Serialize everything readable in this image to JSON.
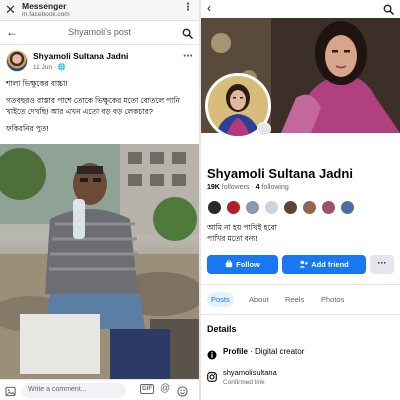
{
  "left": {
    "browser": {
      "title": "Messenger",
      "url": "m.facebook.com"
    },
    "header": {
      "title": "Shyamoli's post"
    },
    "post": {
      "author": "Shyamoli Sultana Jadni",
      "date": "11 Jun",
      "lines": [
        "শালা ভিক্ষুকের বাচ্চা!",
        "গতবছরও রাস্তার পাশে তোকে ভিক্ষুকের মতো বোতলে পানি খাইতে দেখছি! আর এখন এতো বড় বড় লেকচার?",
        "ফকিরনির পুত!"
      ]
    },
    "comment_bar": {
      "placeholder": "Write a comment...",
      "gif_label": "GIF"
    }
  },
  "right": {
    "profile": {
      "name": "Shyamoli Sultana Jadni",
      "followers_count": "19K",
      "followers_label": "followers",
      "following_count": "4",
      "following_label": "following",
      "bio": [
        "আমি না হয় পাখিই হবো",
        "পাখির মতো বন্য!"
      ]
    },
    "buttons": {
      "follow": "Follow",
      "add_friend": "Add friend",
      "more": "···"
    },
    "tabs": [
      "Posts",
      "About",
      "Reels",
      "Photos"
    ],
    "details": {
      "heading": "Details",
      "profile_label": "Profile",
      "profile_type": "Digital creator",
      "instagram_handle": "shyamolisultana",
      "instagram_sub": "Confirmed link"
    }
  },
  "colors": {
    "accent": "#1877f2",
    "text": "#050505",
    "secondary_text": "#65676b"
  }
}
